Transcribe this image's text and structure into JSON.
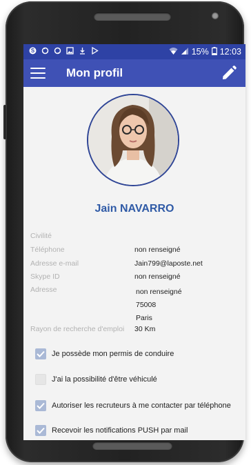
{
  "status_bar": {
    "battery": "15%",
    "time": "12:03",
    "left_icons": [
      "skype-icon",
      "sync-icon",
      "sync-alt-icon",
      "image-icon",
      "download-icon",
      "play-store-icon"
    ]
  },
  "app_bar": {
    "title": "Mon profil"
  },
  "profile": {
    "name": "Jain NAVARRO",
    "fields": [
      {
        "label": "Civilité",
        "value": ""
      },
      {
        "label": "Téléphone",
        "value": "non renseigné"
      },
      {
        "label": "Adresse e-mail",
        "value": "Jain799@laposte.net"
      },
      {
        "label": "Skype ID",
        "value": "non renseigné"
      },
      {
        "label": "Adresse",
        "value": "non renseigné"
      }
    ],
    "address_lines": [
      "75008",
      "Paris"
    ],
    "radius_label": "Rayon de recherche d'emploi",
    "radius_value": "30 Km"
  },
  "options": [
    {
      "label": "Je possède mon permis de conduire",
      "checked": true
    },
    {
      "label": "J'ai la possibilité d'être véhiculé",
      "checked": false
    },
    {
      "label": "Autoriser les recruteurs à me contacter par téléphone",
      "checked": true
    },
    {
      "label": "Recevoir les notifications PUSH par mail",
      "checked": true
    }
  ],
  "colors": {
    "status_bar": "#2e42a5",
    "app_bar": "#3f51b5",
    "name": "#2f5aa6",
    "checked_box": "#aab9d6"
  }
}
